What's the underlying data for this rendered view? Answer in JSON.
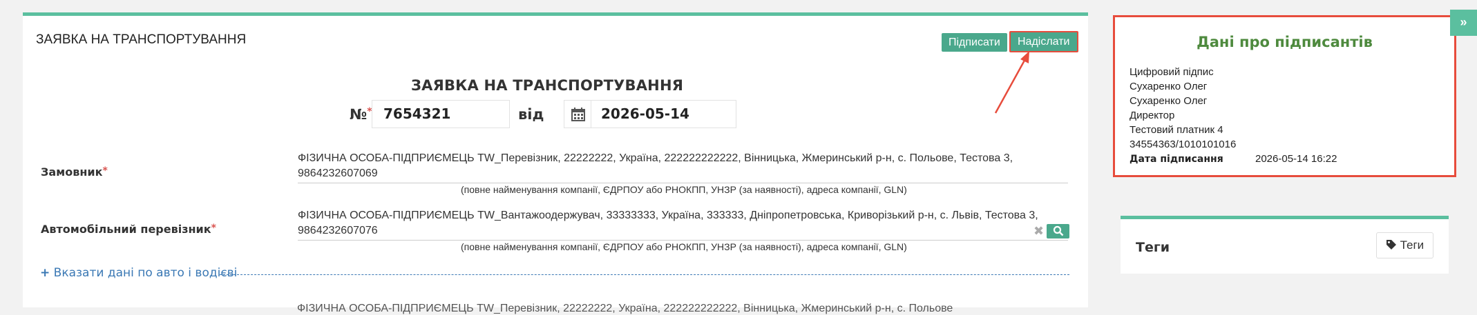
{
  "card": {
    "title": "ЗАЯВКА НА ТРАНСПОРТУВАННЯ",
    "sign_label": "Підписати",
    "send_label": "Надіслати"
  },
  "doc": {
    "heading": "ЗАЯВКА НА ТРАНСПОРТУВАННЯ",
    "number_label": "№",
    "number_value": "7654321",
    "from_label": "від",
    "date_value": "2026-05-14"
  },
  "customer": {
    "label": "Замовник",
    "value": "ФІЗИЧНА ОСОБА-ПІДПРИЄМЕЦЬ TW_Перевізник, 22222222, Україна, 222222222222, Вінницька, Жмеринський р-н, с. Польове, Тестова 3, 9864232607069",
    "hint": "(повне найменування компанії, ЄДРПОУ або РНОКПП, УНЗР (за наявності), адреса компанії, GLN)"
  },
  "carrier": {
    "label": "Автомобільний перевізник",
    "value": "ФІЗИЧНА ОСОБА-ПІДПРИЄМЕЦЬ TW_Вантажоодержувач, 33333333, Україна, 333333, Дніпропетровська, Криворізький р-н, с. Львів, Тестова 3, 9864232607076",
    "hint": "(повне найменування компанії, ЄДРПОУ або РНОКПП, УНЗР (за наявності), адреса компанії, GLN)"
  },
  "add_vehicle_link": "Вказати дані по авто і водієві",
  "truncated_text": "ФІЗИЧНА ОСОБА-ПІДПРИЄМЕЦЬ TW_Перевізник, 22222222, Україна, 222222222222, Вінницька, Жмеринський р-н, с. Польове",
  "signers": {
    "title": "Дані про підписантів",
    "lines": [
      "Цифровий підпис",
      "Сухаренко Олег",
      "Сухаренко Олег",
      "Директор",
      "Тестовий платник 4",
      "34554363/1010101016"
    ],
    "date_label": "Дата підписання",
    "date_value": "2026-05-14 16:22"
  },
  "tags": {
    "title": "Теги",
    "button_label": "Теги"
  },
  "colors": {
    "accent": "#5bbf9f",
    "button": "#4aa88c",
    "highlight": "#e74c3c",
    "signers_title": "#4e8a3e",
    "link": "#3a78b4"
  },
  "icons": [
    "calendar-icon",
    "clear-icon",
    "search-icon",
    "tag-icon",
    "expand-icon",
    "plus-icon"
  ]
}
